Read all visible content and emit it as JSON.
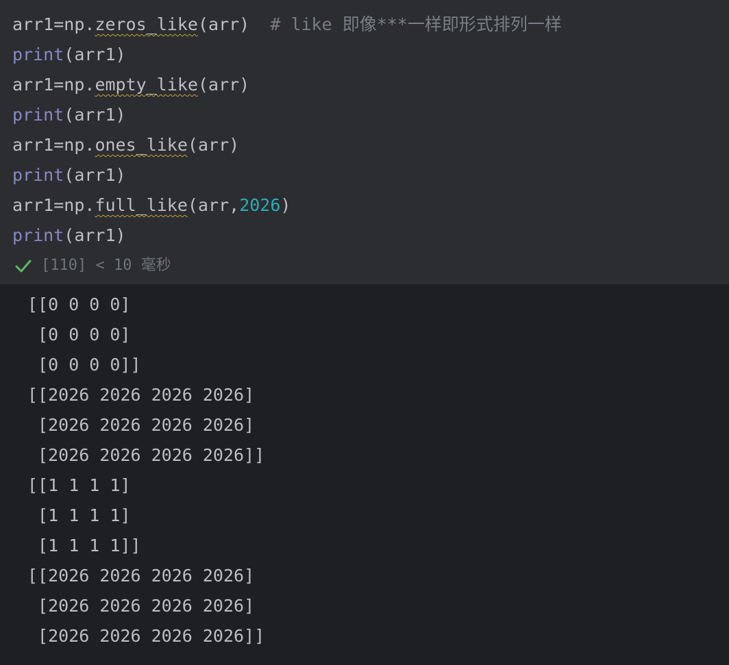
{
  "code": {
    "lines": [
      {
        "var": "arr1",
        "eq": "=",
        "mod": "np.",
        "fn": "zeros_like",
        "open": "(",
        "arg": "arr",
        "extra": "",
        "close": ")",
        "comment": "  # like 即像***一样即形式排列一样"
      },
      {
        "print": "print",
        "args": "(arr1)"
      },
      {
        "var": "arr1",
        "eq": "=",
        "mod": "np.",
        "fn": "empty_like",
        "open": "(",
        "arg": "arr",
        "extra": "",
        "close": ")",
        "comment": ""
      },
      {
        "print": "print",
        "args": "(arr1)"
      },
      {
        "var": "arr1",
        "eq": "=",
        "mod": "np.",
        "fn": "ones_like",
        "open": "(",
        "arg": "arr",
        "extra": "",
        "close": ")",
        "comment": ""
      },
      {
        "print": "print",
        "args": "(arr1)"
      },
      {
        "var": "arr1",
        "eq": "=",
        "mod": "np.",
        "fn": "full_like",
        "open": "(",
        "arg": "arr,",
        "extra": "2026",
        "close": ")",
        "comment": ""
      },
      {
        "print": "print",
        "args": "(arr1)"
      }
    ]
  },
  "status": {
    "icon": "check-icon",
    "text": "[110] < 10 毫秒",
    "success_color": "#5fb865"
  },
  "output": {
    "lines": [
      "[[0 0 0 0]",
      " [0 0 0 0]",
      " [0 0 0 0]]",
      "[[2026 2026 2026 2026]",
      " [2026 2026 2026 2026]",
      " [2026 2026 2026 2026]]",
      "[[1 1 1 1]",
      " [1 1 1 1]",
      " [1 1 1 1]]",
      "[[2026 2026 2026 2026]",
      " [2026 2026 2026 2026]",
      " [2026 2026 2026 2026]]"
    ]
  }
}
